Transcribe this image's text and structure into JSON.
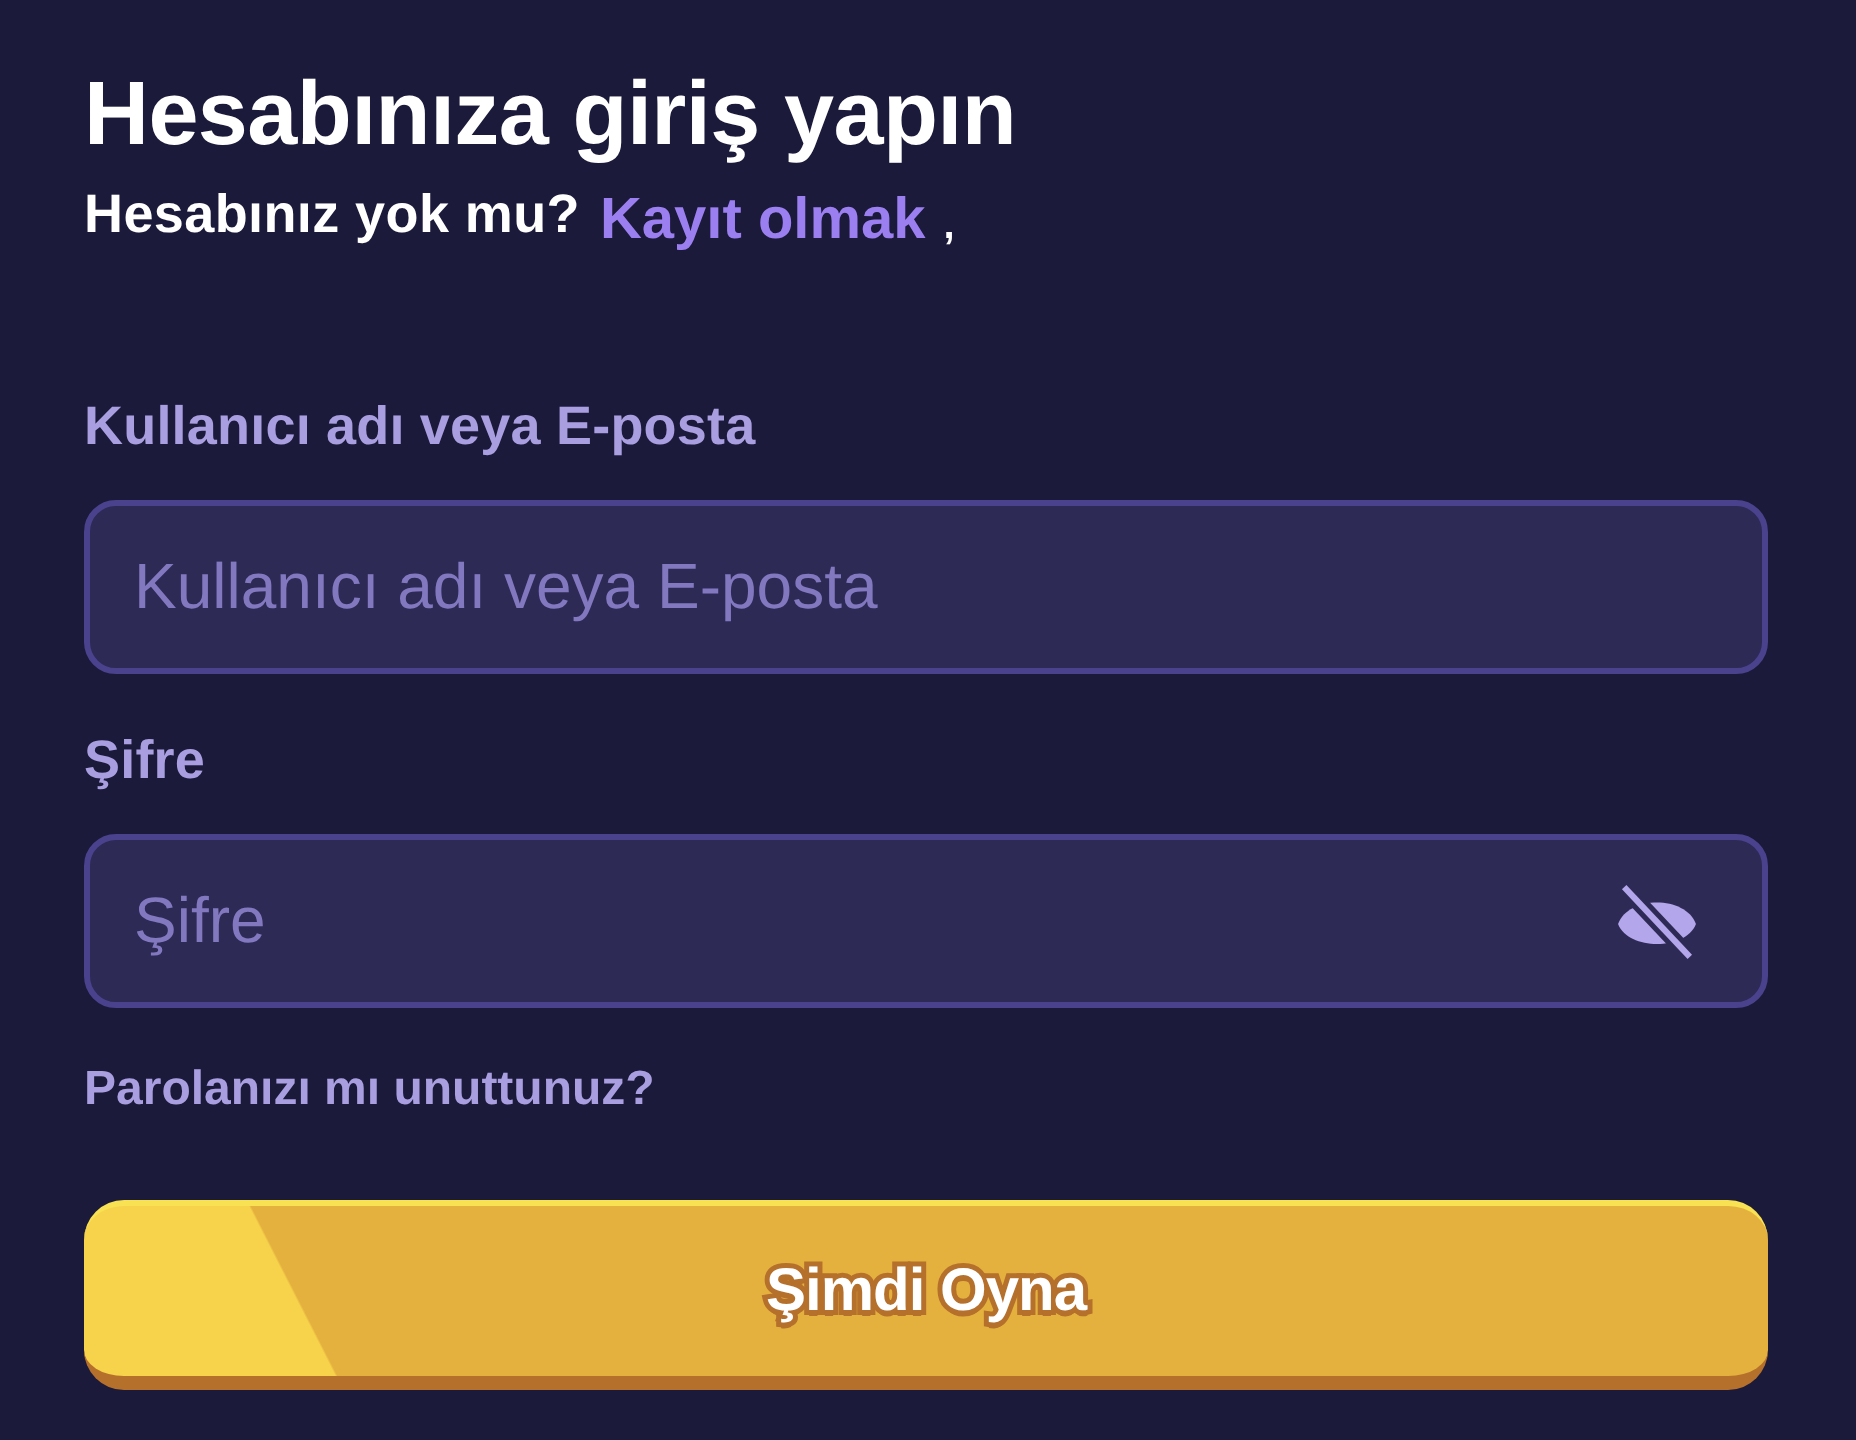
{
  "title": "Hesabınıza giriş yapın",
  "signup": {
    "prompt": "Hesabınız yok mu?",
    "link": "Kayıt olmak",
    "trailing": ","
  },
  "fields": [
    {
      "kind": "text",
      "label": "Kullanıcı adı veya E-posta",
      "placeholder": "Kullanıcı adı veya E-posta"
    },
    {
      "kind": "password",
      "label": "Şifre",
      "placeholder": "Şifre",
      "password_visible": false
    }
  ],
  "forgot_link": "Parolanızı mı unuttunuz?",
  "submit_button": "Şimdi Oyna"
}
